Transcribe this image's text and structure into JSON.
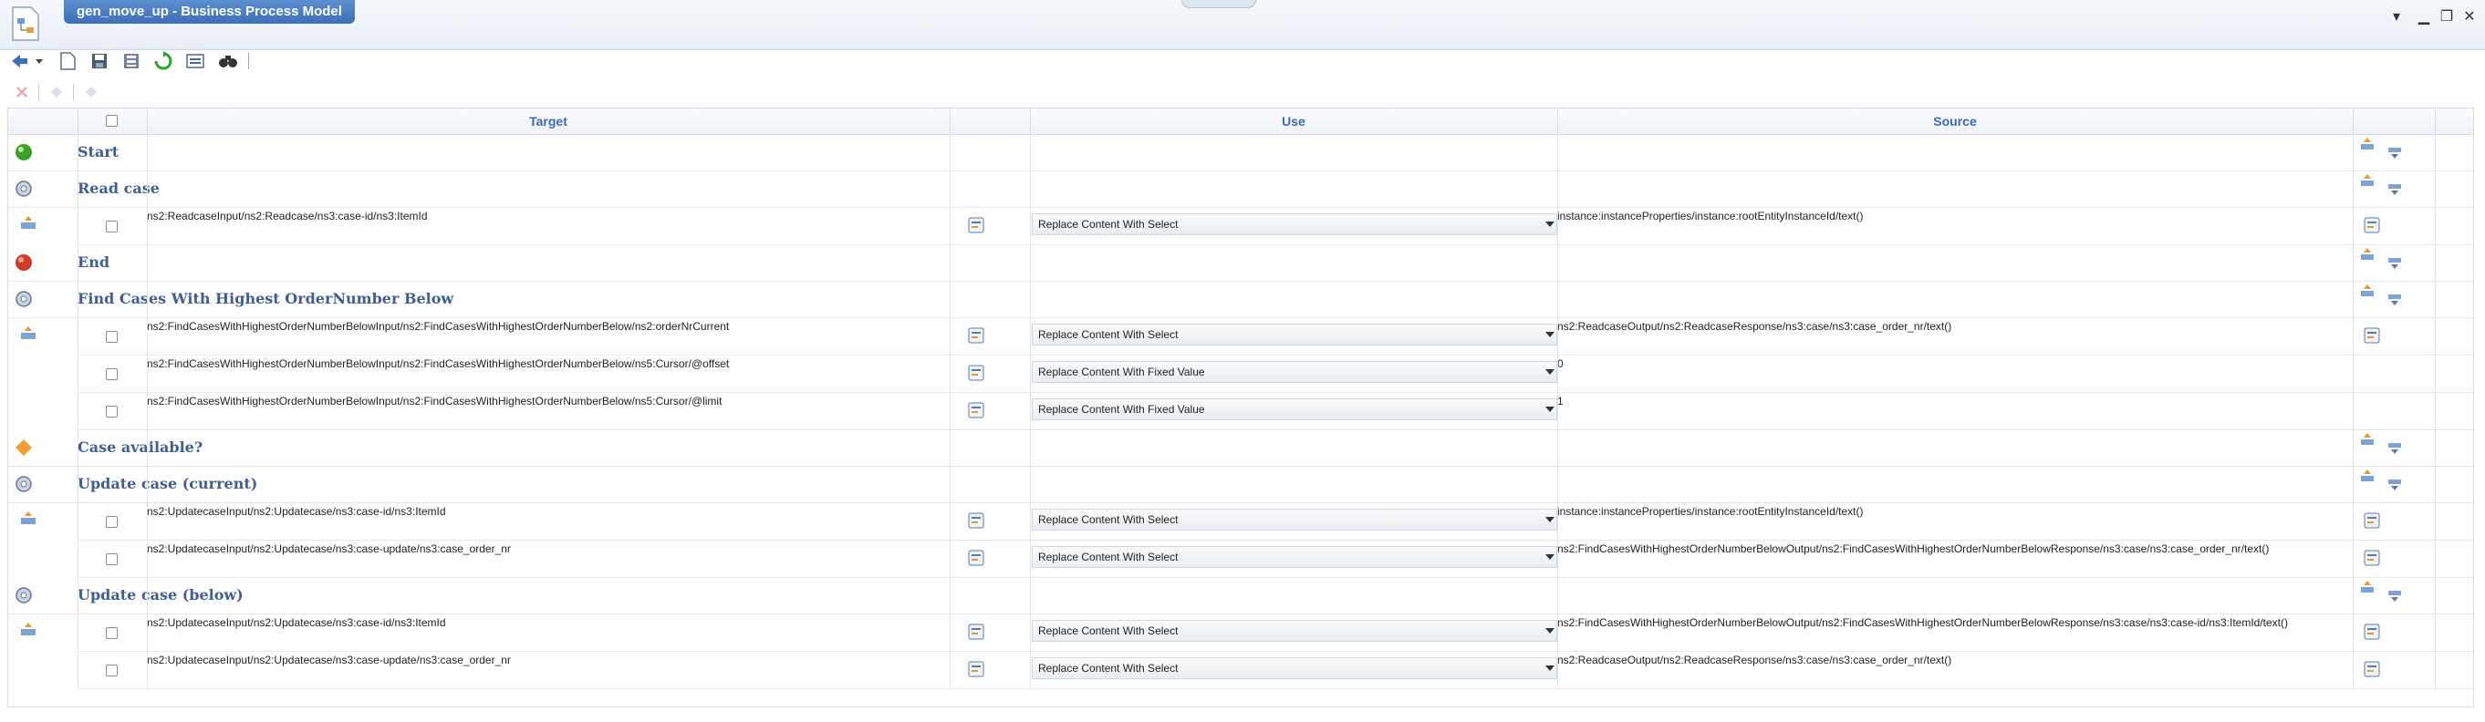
{
  "window": {
    "title": "gen_move_up - Business Process Model",
    "icons": {
      "app": "document-process-icon",
      "minimize": "minimize-icon",
      "restore": "restore-icon",
      "close": "close-icon",
      "menu": "dropdown-menu-icon"
    },
    "controls": {
      "minimize": "▁",
      "restore": "❐",
      "close": "✕",
      "menu": "▾"
    }
  },
  "toolbar": {
    "icons": [
      "back-arrow-icon",
      "chevron-down-icon",
      "new-document-icon",
      "save-icon",
      "save-as-icon",
      "refresh-icon",
      "properties-icon",
      "find-icon"
    ]
  },
  "toolbar2": {
    "icons": [
      "delete-icon",
      "move-up-icon",
      "move-down-icon"
    ]
  },
  "grid": {
    "headers": {
      "target": "Target",
      "use": "Use",
      "source": "Source"
    },
    "steps": [
      {
        "name": "Start",
        "icon": "start-event-icon",
        "color": "#3aa02a",
        "mappings": []
      },
      {
        "name": "Read case",
        "icon": "service-task-icon",
        "mappings": [
          {
            "target": "ns2:ReadcaseInput/ns2:Readcase/ns3:case-id/ns3:ItemId",
            "use": "Replace Content With Select",
            "source": "instance:instanceProperties/instance:rootEntityInstanceId/text()"
          }
        ]
      },
      {
        "name": "End",
        "icon": "end-event-icon",
        "color": "#d03a2a",
        "mappings": []
      },
      {
        "name": "Find Cases With Highest OrderNumber Below",
        "icon": "service-task-icon",
        "mappings": [
          {
            "target": "ns2:FindCasesWithHighestOrderNumberBelowInput/ns2:FindCasesWithHighestOrderNumberBelow/ns2:orderNrCurrent",
            "use": "Replace Content With Select",
            "source": "ns2:ReadcaseOutput/ns2:ReadcaseResponse/ns3:case/ns3:case_order_nr/text()"
          },
          {
            "target": "ns2:FindCasesWithHighestOrderNumberBelowInput/ns2:FindCasesWithHighestOrderNumberBelow/ns5:Cursor/@offset",
            "use": "Replace Content With Fixed Value",
            "source": "0"
          },
          {
            "target": "ns2:FindCasesWithHighestOrderNumberBelowInput/ns2:FindCasesWithHighestOrderNumberBelow/ns5:Cursor/@limit",
            "use": "Replace Content With Fixed Value",
            "source": "1"
          }
        ]
      },
      {
        "name": "Case available?",
        "icon": "decision-gateway-icon",
        "color": "#f0a030",
        "mappings": []
      },
      {
        "name": "Update case (current)",
        "icon": "service-task-icon",
        "mappings": [
          {
            "target": "ns2:UpdatecaseInput/ns2:Updatecase/ns3:case-id/ns3:ItemId",
            "use": "Replace Content With Select",
            "source": "instance:instanceProperties/instance:rootEntityInstanceId/text()"
          },
          {
            "target": "ns2:UpdatecaseInput/ns2:Updatecase/ns3:case-update/ns3:case_order_nr",
            "use": "Replace Content With Select",
            "source": "ns2:FindCasesWithHighestOrderNumberBelowOutput/ns2:FindCasesWithHighestOrderNumberBelowResponse/ns3:case/ns3:case_order_nr/text()"
          }
        ]
      },
      {
        "name": "Update case (below)",
        "icon": "service-task-icon",
        "mappings": [
          {
            "target": "ns2:UpdatecaseInput/ns2:Updatecase/ns3:case-id/ns3:ItemId",
            "use": "Replace Content With Select",
            "source": "ns2:FindCasesWithHighestOrderNumberBelowOutput/ns2:FindCasesWithHighestOrderNumberBelowResponse/ns3:case/ns3:case-id/ns3:ItemId/text()"
          },
          {
            "target": "ns2:UpdatecaseInput/ns2:Updatecase/ns3:case-update/ns3:case_order_nr",
            "use": "Replace Content With Select",
            "source": "ns2:ReadcaseOutput/ns2:ReadcaseResponse/ns3:case/ns3:case_order_nr/text()"
          }
        ]
      }
    ]
  }
}
